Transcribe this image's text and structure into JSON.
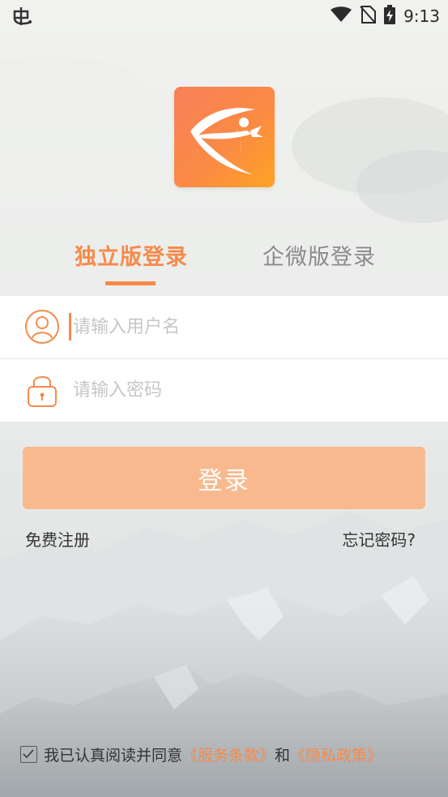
{
  "status_bar": {
    "time": "9:13",
    "icons": [
      "bug-icon",
      "wifi-icon",
      "no-sim-icon",
      "battery-charging-icon"
    ]
  },
  "app": {
    "logo_icon": "bow-and-arrow-logo-icon",
    "brand_gradient": [
      "#f8805a",
      "#fda324"
    ]
  },
  "tabs": [
    {
      "label": "独立版登录",
      "active": true
    },
    {
      "label": "企微版登录",
      "active": false
    }
  ],
  "form": {
    "username_placeholder": "请输入用户名",
    "username_icon": "user-icon",
    "password_placeholder": "请输入密码",
    "password_icon": "lock-icon"
  },
  "actions": {
    "login_label": "登录",
    "register_label": "免费注册",
    "forgot_label": "忘记密码?"
  },
  "agreement": {
    "checked": true,
    "prefix": "我已认真阅读并同意",
    "terms_label": "《服务条款》",
    "and_text": "和",
    "privacy_label": "《隐私政策》"
  },
  "colors": {
    "accent": "#f78a4a",
    "login_button": "#f8b98f",
    "inactive_tab": "#8a8a8a"
  }
}
